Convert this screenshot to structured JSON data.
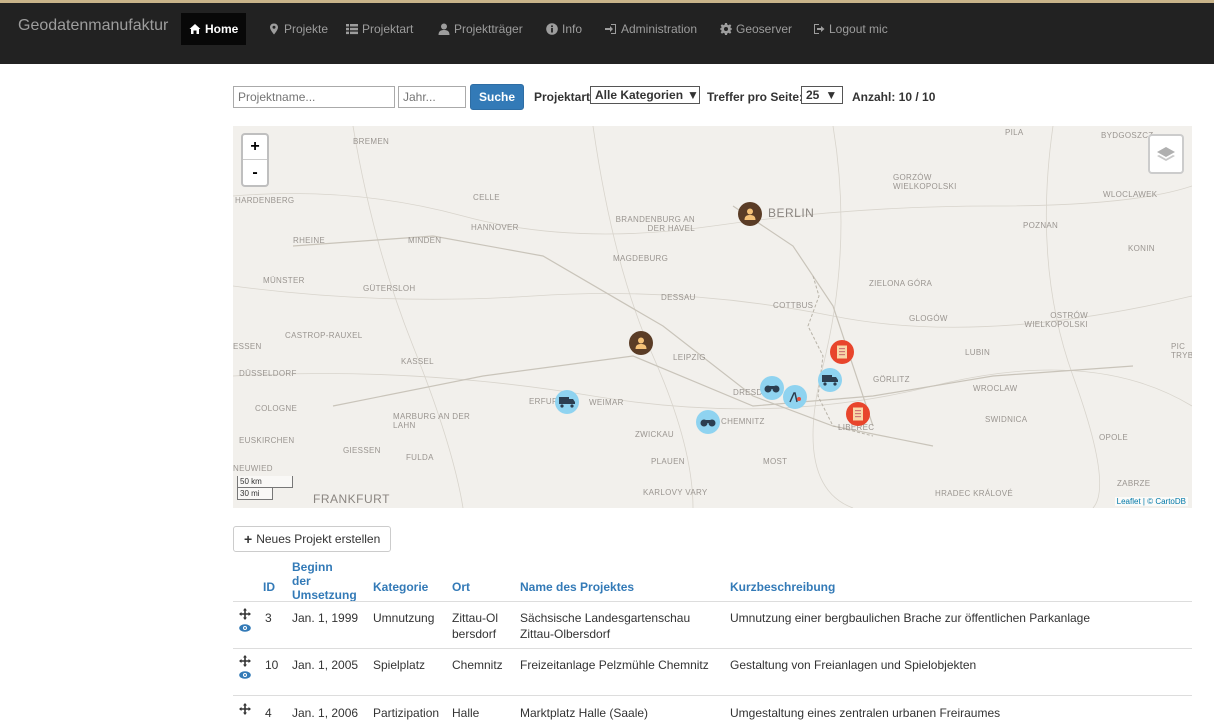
{
  "navbar": {
    "brand": "Geodatenmanufaktur",
    "items": [
      {
        "label": "Home",
        "icon": "home-icon"
      },
      {
        "label": "Projekte",
        "icon": "map-marker-icon"
      },
      {
        "label": "Projektart",
        "icon": "list-icon"
      },
      {
        "label": "Projektträger",
        "icon": "user-icon"
      },
      {
        "label": "Info",
        "icon": "info-icon"
      },
      {
        "label": "Administration",
        "icon": "login-icon"
      },
      {
        "label": "Geoserver",
        "icon": "gear-icon"
      },
      {
        "label": "Logout mic",
        "icon": "logout-icon"
      }
    ]
  },
  "search": {
    "name_placeholder": "Projektname...",
    "year_placeholder": "Jahr...",
    "button": "Suche",
    "category_label": "Projektart:",
    "category_value": "Alle Kategorien",
    "per_page_label": "Treffer pro Seite:",
    "per_page_value": "25",
    "count": "Anzahl: 10 / 10"
  },
  "map": {
    "zoom_in": "+",
    "zoom_out": "-",
    "scale_km": "50 km",
    "scale_mi": "30 mi",
    "attribution": "Leaflet | © CartoDB",
    "cities": [
      "BREMEN",
      "HARDENBERG",
      "CELLE",
      "HANNOVER",
      "RHEINE",
      "MINDEN",
      "BRANDENBURG AN DER HAVEL",
      "BERLIN",
      "GORZÓW WIELKOPOLSKI",
      "POZNAN",
      "WLOCLAWEK",
      "KONIN",
      "MÜNSTER",
      "GÜTERSLOH",
      "MAGDEBURG",
      "DESSAU",
      "ZIELONA GÓRA",
      "COTTBUS",
      "GLOGÓW",
      "OSTRÓW WIELKOPOLSKI",
      "CASTROP-RAUXEL",
      "ESSEN",
      "KASSEL",
      "LEIPZIG",
      "LUBIN",
      "DÜSSELDORF",
      "GÖRLITZ",
      "WROCLAW",
      "DRESDEN",
      "COLOGNE",
      "ERFURT",
      "WEIMAR",
      "MARBURG AN DER LAHN",
      "CHEMNITZ",
      "LIBEREC",
      "SWIDNICA",
      "EUSKIRCHEN",
      "GIESSEN",
      "FULDA",
      "ZWICKAU",
      "OPOLE",
      "NEUWIED",
      "PLAUEN",
      "MOST",
      "FRANKFURT",
      "KARLOVY VARY",
      "HRADEC KRÁLOVÉ",
      "ZABRZE",
      "PILA",
      "BYDGOSZCZ",
      "PIC TRYB"
    ]
  },
  "new_project_button": "Neues Projekt erstellen",
  "table": {
    "headers": [
      "ID",
      "Beginn der Umsetzung",
      "Kategorie",
      "Ort",
      "Name des Projektes",
      "Kurzbeschreibung"
    ],
    "rows": [
      {
        "id": "3",
        "date": "Jan. 1, 1999",
        "category": "Umnutzung",
        "place": "Zittau-Olbersdorf",
        "name": "Sächsische Landesgartenschau Zittau-Olbersdorf",
        "desc": "Umnutzung einer bergbaulichen Brache zur öffentlichen Parkanlage"
      },
      {
        "id": "10",
        "date": "Jan. 1, 2005",
        "category": "Spielplatz",
        "place": "Chemnitz",
        "name": "Freizeitanlage Pelzmühle Chemnitz",
        "desc": "Gestaltung von Freianlagen und Spielobjekten"
      },
      {
        "id": "4",
        "date": "Jan. 1, 2006",
        "category": "Partizipation",
        "place": "Halle",
        "name": "Marktplatz Halle (Saale)",
        "desc": "Umgestaltung eines zentralen urbanen Freiraumes"
      }
    ]
  },
  "colors": {
    "navbar": "#222222",
    "primary": "#337ab7",
    "marker_brown": "#5a3c26",
    "marker_red": "#e8452c",
    "marker_blue": "#8fd3f0"
  }
}
